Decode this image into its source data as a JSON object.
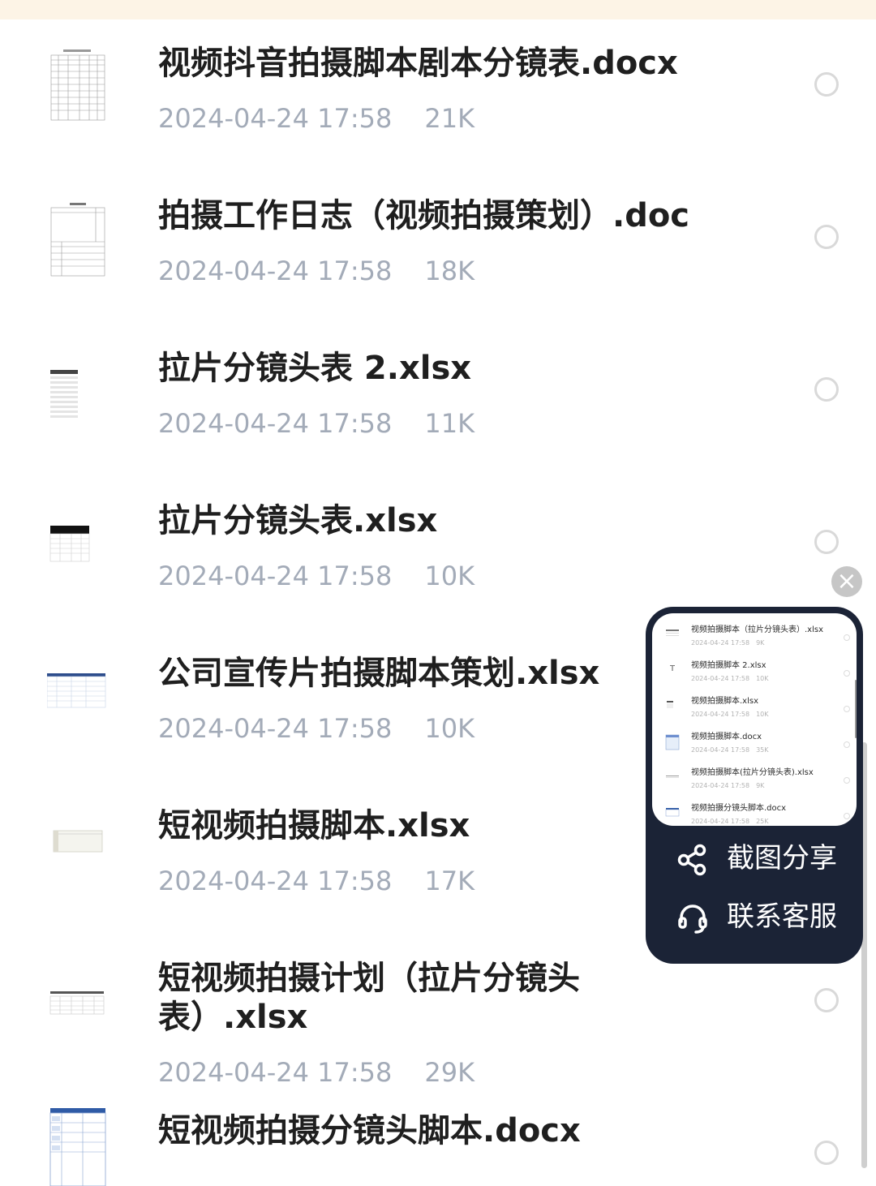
{
  "files": [
    {
      "name": "视频抖音拍摄脚本剧本分镜表.docx",
      "date": "2024-04-24 17:58",
      "size": "21K",
      "thumb_icon": "doc-table-thumbnail"
    },
    {
      "name": "拍摄工作日志（视频拍摄策划）.doc",
      "date": "2024-04-24 17:58",
      "size": "18K",
      "thumb_icon": "doc-form-thumbnail"
    },
    {
      "name": "拉片分镜头表 2.xlsx",
      "date": "2024-04-24 17:58",
      "size": "11K",
      "thumb_icon": "sheet-thumbnail"
    },
    {
      "name": "拉片分镜头表.xlsx",
      "date": "2024-04-24 17:58",
      "size": "10K",
      "thumb_icon": "sheet-dark-header-thumbnail"
    },
    {
      "name": "公司宣传片拍摄脚本策划.xlsx",
      "date": "2024-04-24 17:58",
      "size": "10K",
      "thumb_icon": "sheet-blue-header-thumbnail"
    },
    {
      "name": "短视频拍摄脚本.xlsx",
      "date": "2024-04-24 17:58",
      "size": "17K",
      "thumb_icon": "sheet-small-thumbnail"
    },
    {
      "name": "短视频拍摄计划（拉片分镜头表）.xlsx",
      "date": "2024-04-24 17:58",
      "size": "29K",
      "thumb_icon": "sheet-thumbnail"
    },
    {
      "name": "短视频拍摄分镜头脚本.docx",
      "date": "",
      "size": "",
      "thumb_icon": "doc-blue-table-thumbnail"
    }
  ],
  "float_panel": {
    "close_icon": "close-icon",
    "preview_items": [
      {
        "name": "视频拍摄脚本（拉片分镜头表）.xlsx",
        "date": "2024-04-24 17:58",
        "size": "9K"
      },
      {
        "name": "视频拍摄脚本 2.xlsx",
        "date": "2024-04-24 17:58",
        "size": "10K"
      },
      {
        "name": "视频拍摄脚本.xlsx",
        "date": "2024-04-24 17:58",
        "size": "10K"
      },
      {
        "name": "视频拍摄脚本.docx",
        "date": "2024-04-24 17:58",
        "size": "35K"
      },
      {
        "name": "视频拍摄脚本(拉片分镜头表).xlsx",
        "date": "2024-04-24 17:58",
        "size": "9K"
      },
      {
        "name": "视频拍摄分镜头脚本.docx",
        "date": "2024-04-24 17:58",
        "size": "25K"
      }
    ],
    "actions": [
      {
        "label": "截图分享",
        "icon": "share-icon"
      },
      {
        "label": "联系客服",
        "icon": "headset-icon"
      }
    ]
  },
  "colors": {
    "title": "#1f1f1f",
    "meta": "#a3abb8",
    "panel_bg": "#1b2336",
    "top_strip": "#fdf4e6"
  }
}
